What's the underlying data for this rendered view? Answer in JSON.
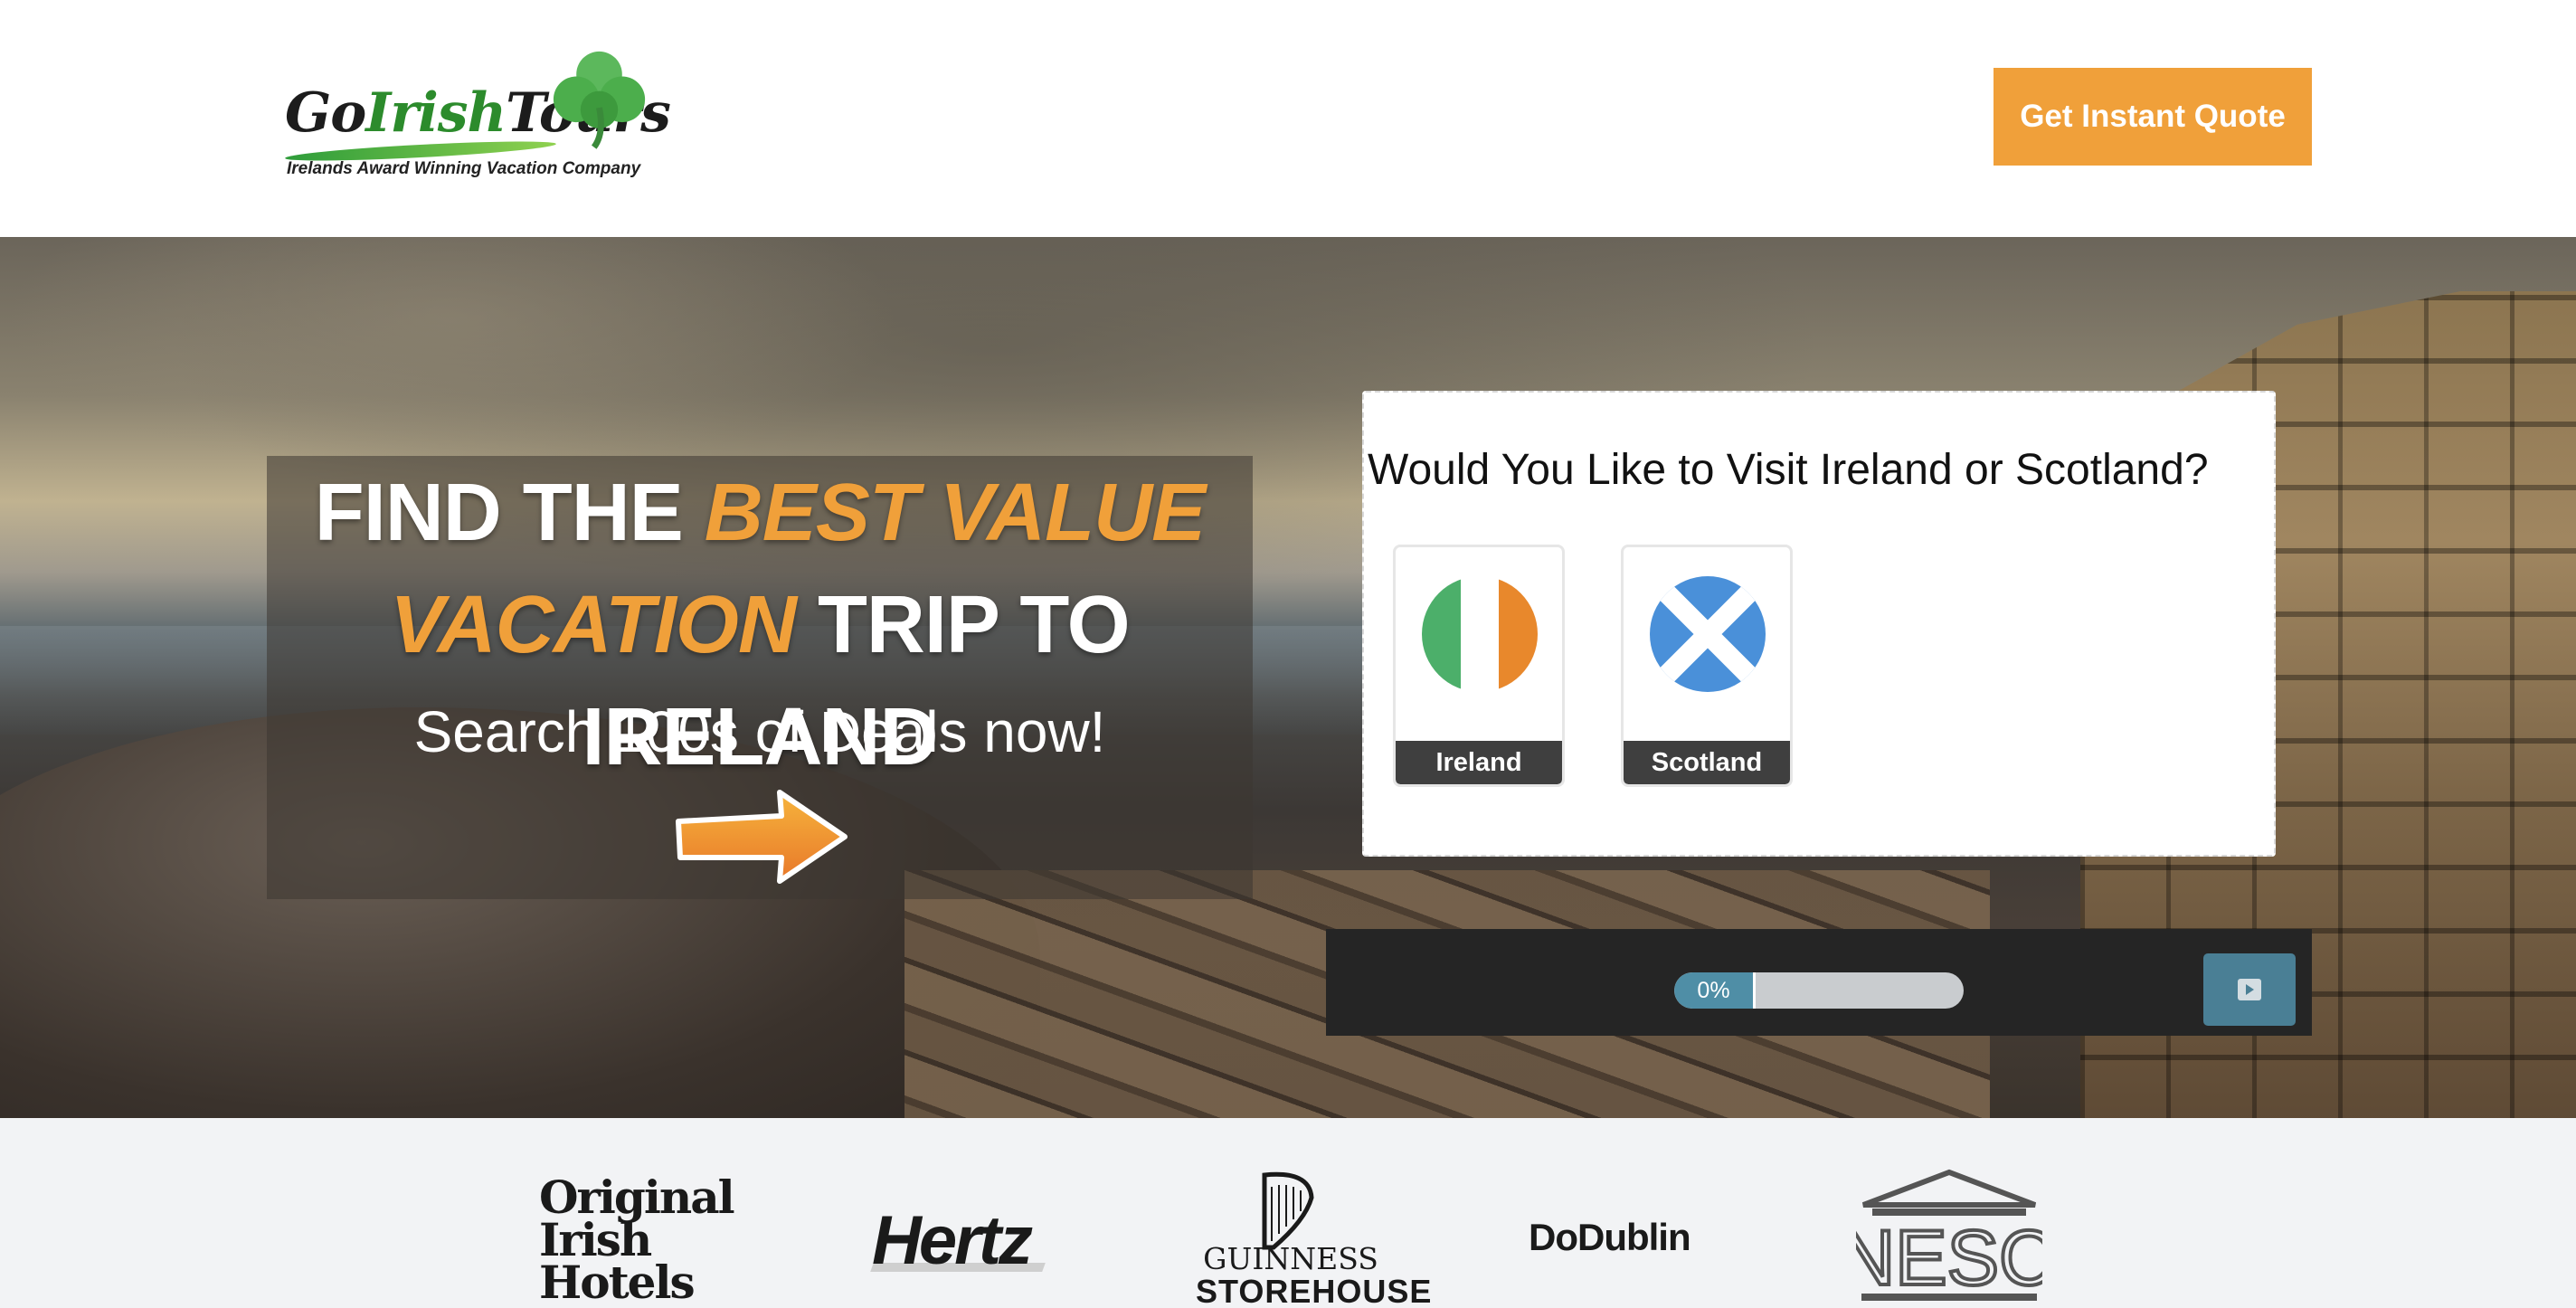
{
  "header": {
    "logo": {
      "wordmark_go": "Go",
      "wordmark_irish": "Irish",
      "wordmark_tours": "Tours",
      "tagline": "Irelands Award Winning Vacation Company"
    },
    "cta_label": "Get Instant Quote",
    "cta_color": "#f0a03a"
  },
  "hero": {
    "headline_1": "FIND THE",
    "headline_accent_1": "BEST VALUE",
    "headline_accent_2": "VACATION",
    "headline_2": "TRIP TO IRELAND",
    "subheadline": "Search 100s of Deals now!",
    "arrow_icon": "arrow-right-icon"
  },
  "quiz": {
    "question": "Would You Like to Visit Ireland or Scotland?",
    "options": [
      {
        "label": "Ireland",
        "flag_icon": "ireland-flag-icon",
        "colors": [
          "#4caf6a",
          "#ffffff",
          "#e8882c"
        ]
      },
      {
        "label": "Scotland",
        "flag_icon": "scotland-flag-icon",
        "colors": [
          "#4a90d9",
          "#ffffff"
        ]
      }
    ],
    "progress": {
      "percent": 0,
      "label": "0%"
    },
    "next_icon": "next-arrow-icon"
  },
  "partners": {
    "original_irish_hotels": [
      "Original",
      "Irish",
      "Hotels"
    ],
    "hertz": "Hertz",
    "guinness": "GUINNESS",
    "guinness_storehouse": "STOREHOUSE",
    "dodublin": "DoDublin",
    "unesco": "UNESCO"
  }
}
